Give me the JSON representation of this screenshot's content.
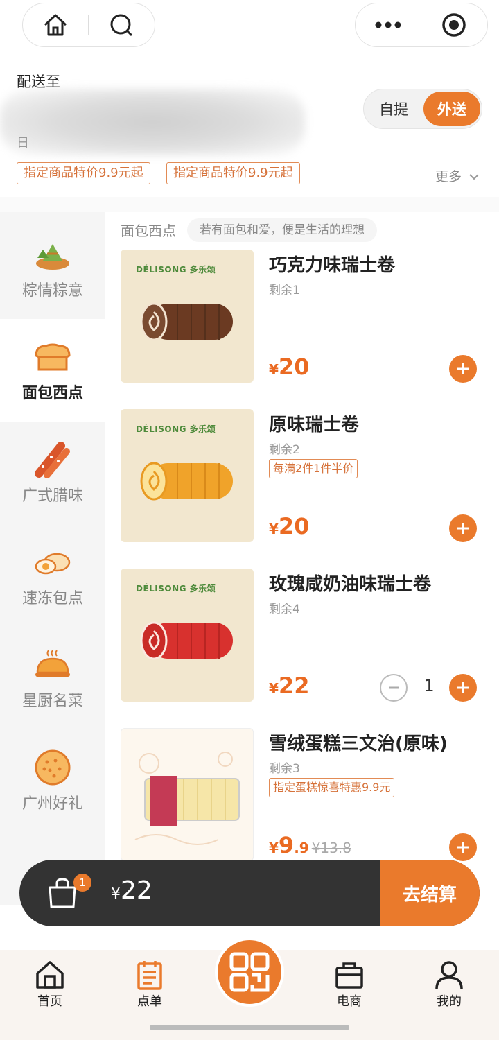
{
  "header": {
    "delivery_label": "配送至",
    "address_partial": "日",
    "mode": {
      "pickup": "自提",
      "delivery": "外送",
      "selected": "外送"
    },
    "promos": [
      "指定商品特价9.9元起",
      "指定商品特价9.9元起"
    ],
    "more": "更多"
  },
  "sidebar": {
    "items": [
      {
        "label": "粽情粽意",
        "icon": "zongzi-icon"
      },
      {
        "label": "面包西点",
        "icon": "bread-icon",
        "active": true
      },
      {
        "label": "广式腊味",
        "icon": "sausage-icon"
      },
      {
        "label": "速冻包点",
        "icon": "bun-icon"
      },
      {
        "label": "星厨名菜",
        "icon": "dish-icon"
      },
      {
        "label": "广州好礼",
        "icon": "cookie-icon"
      }
    ]
  },
  "section": {
    "title": "面包西点",
    "slogan": "若有面包和爱，便是生活的理想"
  },
  "products": [
    {
      "name": "巧克力味瑞士卷",
      "stock": "剩余1",
      "price": "20",
      "brand": "DÉLISONG 多乐颂",
      "roll_color": "#6b3a22"
    },
    {
      "name": "原味瑞士卷",
      "stock": "剩余2",
      "tag": "每满2件1件半价",
      "price": "20",
      "brand": "DÉLISONG 多乐颂",
      "roll_color": "#f0a32a"
    },
    {
      "name": "玫瑰咸奶油味瑞士卷",
      "stock": "剩余4",
      "price": "22",
      "quantity": "1",
      "brand": "DÉLISONG 多乐颂",
      "roll_color": "#d8312e"
    },
    {
      "name": "雪绒蛋糕三文治(原味)",
      "stock": "剩余3",
      "tag": "指定蛋糕惊喜特惠9.9元",
      "price": "9",
      "price_decimal": ".9",
      "original_price": "¥13.8"
    }
  ],
  "currency": "¥",
  "cart": {
    "count": "1",
    "total": "22",
    "checkout": "去结算"
  },
  "tabbar": {
    "items": [
      {
        "label": "首页",
        "icon": "home-icon"
      },
      {
        "label": "点单",
        "icon": "order-icon"
      },
      {
        "label": "",
        "icon": "qr-scan-icon"
      },
      {
        "label": "电商",
        "icon": "shop-bag-icon"
      },
      {
        "label": "我的",
        "icon": "profile-icon"
      }
    ]
  },
  "colors": {
    "accent": "#ea7a2c",
    "price": "#ea6a22",
    "dark_bar": "#333333"
  }
}
